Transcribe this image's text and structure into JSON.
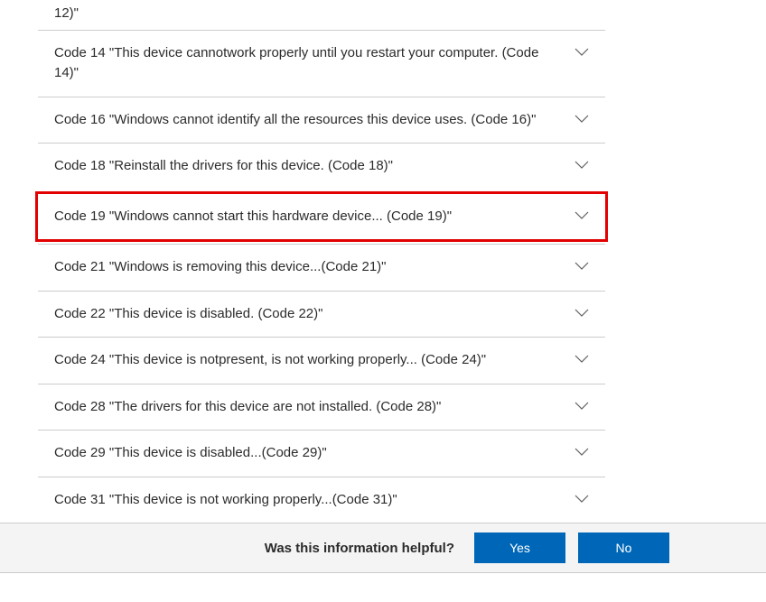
{
  "partial_top": "12)\"",
  "items": [
    {
      "label": "Code 14 \"This device cannotwork properly until you restart your computer. (Code 14)\"",
      "highlighted": false
    },
    {
      "label": "Code 16 \"Windows cannot identify all the resources this device uses. (Code 16)\"",
      "highlighted": false
    },
    {
      "label": "Code 18 \"Reinstall the drivers for this device. (Code 18)\"",
      "highlighted": false
    },
    {
      "label": "Code 19 \"Windows cannot start this hardware device... (Code 19)\"",
      "highlighted": true
    },
    {
      "label": "Code 21 \"Windows is removing this device...(Code 21)\"",
      "highlighted": false
    },
    {
      "label": "Code 22 \"This device is disabled. (Code 22)\"",
      "highlighted": false
    },
    {
      "label": "Code 24 \"This device is notpresent, is not working properly... (Code 24)\"",
      "highlighted": false
    },
    {
      "label": "Code 28 \"The drivers for this device are not installed. (Code 28)\"",
      "highlighted": false
    },
    {
      "label": "Code 29 \"This device is disabled...(Code 29)\"",
      "highlighted": false
    },
    {
      "label": "Code 31 \"This device is not working properly...(Code 31)\"",
      "highlighted": false
    }
  ],
  "feedback": {
    "question": "Was this information helpful?",
    "yes": "Yes",
    "no": "No"
  }
}
